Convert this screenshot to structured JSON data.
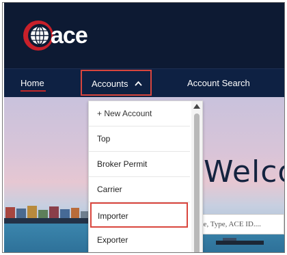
{
  "app": {
    "logo_text": "ace"
  },
  "nav": {
    "home": "Home",
    "accounts": "Accounts",
    "accounts_chevron": "^",
    "account_search": "Account Search"
  },
  "hero": {
    "welcome": "Welco",
    "search_placeholder": "me, Type, ACE ID...."
  },
  "dropdown": {
    "items": [
      {
        "label": "+ New Account"
      },
      {
        "label": "Top"
      },
      {
        "label": "Broker Permit"
      },
      {
        "label": "Carrier"
      },
      {
        "label": "Importer"
      },
      {
        "label": "Exporter"
      }
    ],
    "highlighted": "Importer"
  },
  "colors": {
    "header_bg": "#0d1a33",
    "nav_bg": "#0e2143",
    "accent_red": "#d9453d"
  },
  "icons": [
    "globe-logo-icon",
    "chevron-up-icon",
    "scroll-up-arrow-icon"
  ]
}
